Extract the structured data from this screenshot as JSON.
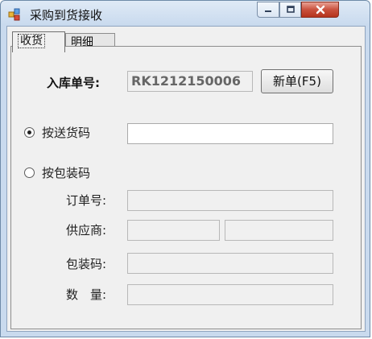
{
  "window": {
    "title": "采购到货接收",
    "icons": {
      "app": "app-icon",
      "minimize": "minimize-icon",
      "maximize": "maximize-icon",
      "close": "close-icon"
    }
  },
  "tabs": [
    {
      "label": "收货"
    },
    {
      "label": "明细"
    }
  ],
  "receive_panel": {
    "receipt_no_label": "入库单号:",
    "receipt_no_value": "RK1212150006",
    "new_button_label": "新单(F5)",
    "radio_delivery_label": "按送货码",
    "radio_package_label": "按包装码",
    "order_no_label": "订单号:",
    "supplier_label": "供应商:",
    "package_code_label": "包装码:",
    "quantity_label": "数　量:",
    "delivery_code_value": "",
    "order_no_value": "",
    "supplier_code_value": "",
    "supplier_name_value": "",
    "package_code_value": "",
    "quantity_value": ""
  }
}
